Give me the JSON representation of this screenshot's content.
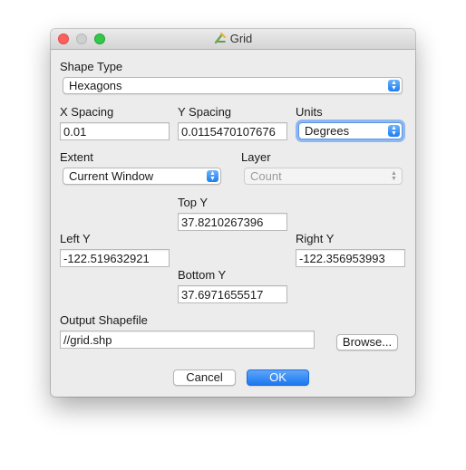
{
  "window": {
    "title": "Grid"
  },
  "shape_type": {
    "label": "Shape Type",
    "value": "Hexagons"
  },
  "x_spacing": {
    "label": "X Spacing",
    "value": "0.01"
  },
  "y_spacing": {
    "label": "Y Spacing",
    "value": "0.0115470107676"
  },
  "units": {
    "label": "Units",
    "value": "Degrees"
  },
  "extent": {
    "label": "Extent",
    "value": "Current Window"
  },
  "layer": {
    "label": "Layer",
    "value": "Count"
  },
  "top_y": {
    "label": "Top Y",
    "value": "37.8210267396"
  },
  "left_y": {
    "label": "Left Y",
    "value": "-122.519632921"
  },
  "right_y": {
    "label": "Right Y",
    "value": "-122.356953993"
  },
  "bottom_y": {
    "label": "Bottom Y",
    "value": "37.6971655517"
  },
  "output": {
    "label": "Output Shapefile",
    "value": "//grid.shp",
    "browse_label": "Browse..."
  },
  "buttons": {
    "cancel": "Cancel",
    "ok": "OK"
  },
  "colors": {
    "accent": "#1b79f1",
    "close": "#fc605c",
    "zoom": "#34c84a"
  }
}
